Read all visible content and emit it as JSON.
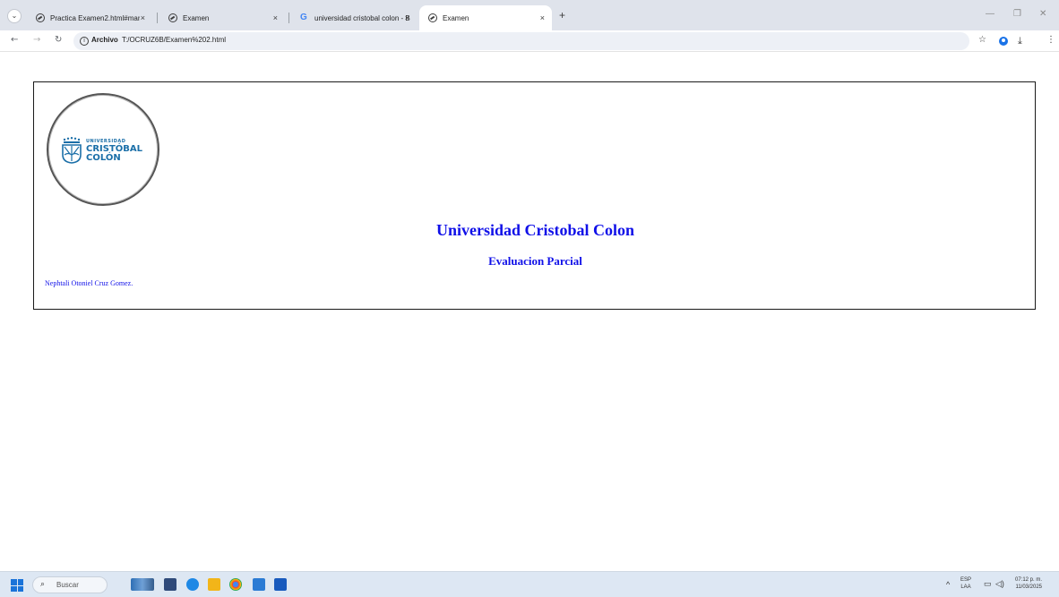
{
  "browser": {
    "tabs": [
      {
        "title": "Practica Examen2.html#manzan",
        "icon": "globe-icon",
        "active": false
      },
      {
        "title": "Examen",
        "icon": "globe-icon",
        "active": false
      },
      {
        "title": "universidad cristobal colon - B",
        "icon": "google-icon",
        "active": false
      },
      {
        "title": "Examen",
        "icon": "globe-icon",
        "active": true
      }
    ],
    "close_glyph": "×",
    "new_tab": "+",
    "address": {
      "chip": "Archivo",
      "url": "T:/OCRUZ6B/Examen%202.html"
    }
  },
  "page": {
    "logo": {
      "line1": "UNIVERSIDAD",
      "line2": "CRISTÓBAL",
      "line3": "COLÓN",
      "color": "#1b6fa8"
    },
    "title": "Universidad Cristobal Colon",
    "subtitle": "Evaluacion Parcial",
    "author": "Nephtali Otoniel Cruz Gomez.",
    "text_color": "#1010e8"
  },
  "taskbar": {
    "search_placeholder": "Buscar",
    "language": "ESP",
    "layout": "LAA",
    "time": "07:12 p. m.",
    "date": "11/03/2025"
  }
}
